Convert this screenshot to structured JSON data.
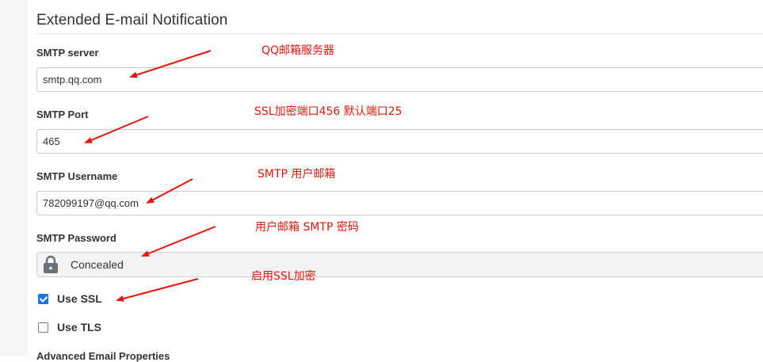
{
  "section": {
    "title": "Extended E-mail Notification"
  },
  "fields": {
    "smtp_server": {
      "label": "SMTP server",
      "value": "smtp.qq.com"
    },
    "smtp_port": {
      "label": "SMTP Port",
      "value": "465"
    },
    "smtp_username": {
      "label": "SMTP Username",
      "value": "782099197@qq.com"
    },
    "smtp_password": {
      "label": "SMTP Password",
      "concealed_text": "Concealed",
      "icon": "lock-icon"
    }
  },
  "options": {
    "use_ssl": {
      "label": "Use SSL",
      "checked": true
    },
    "use_tls": {
      "label": "Use TLS",
      "checked": false
    }
  },
  "next_label": "Advanced Email Properties",
  "annotations": {
    "server": "QQ邮箱服务器",
    "port": "SSL加密端口456  默认端口25",
    "username": "SMTP 用户邮箱",
    "password": "用户邮箱 SMTP 密码",
    "ssl": "启用SSL加密"
  },
  "colors": {
    "annotation": "#e8140c",
    "checkbox_accent": "#1a73e8"
  }
}
